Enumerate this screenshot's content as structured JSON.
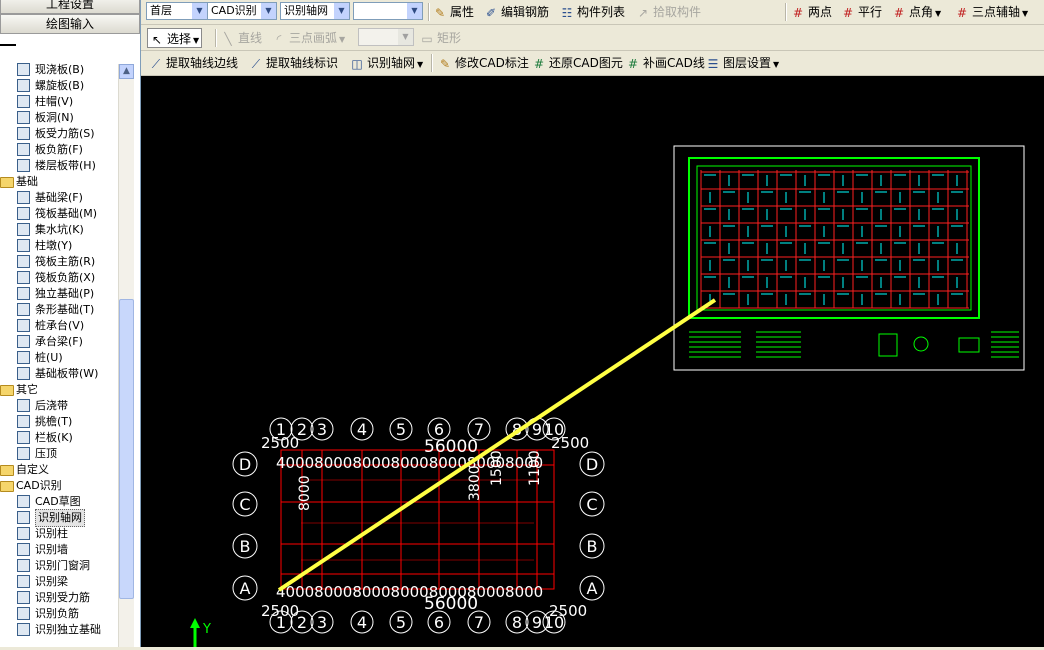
{
  "left_panel": {
    "top_buttons": [
      "工程设置",
      "绘图输入"
    ],
    "tree_items": [
      {
        "label": "现浇板(B)",
        "icon": "cast-slab-icon"
      },
      {
        "label": "螺旋板(B)",
        "icon": "spiral-slab-icon"
      },
      {
        "label": "柱帽(V)",
        "icon": "column-cap-icon"
      },
      {
        "label": "板洞(N)",
        "icon": "slab-hole-icon"
      },
      {
        "label": "板受力筋(S)",
        "icon": "slab-rebar-icon"
      },
      {
        "label": "板负筋(F)",
        "icon": "slab-negative-rebar-icon"
      },
      {
        "label": "楼层板带(H)",
        "icon": "floor-strip-icon"
      },
      {
        "label": "基础",
        "folder": true,
        "icon": "folder-icon"
      },
      {
        "label": "基础梁(F)",
        "icon": "foundation-beam-icon"
      },
      {
        "label": "筏板基础(M)",
        "icon": "raft-foundation-icon"
      },
      {
        "label": "集水坑(K)",
        "icon": "sump-pit-icon"
      },
      {
        "label": "柱墩(Y)",
        "icon": "column-pier-icon"
      },
      {
        "label": "筏板主筋(R)",
        "icon": "raft-main-rebar-icon"
      },
      {
        "label": "筏板负筋(X)",
        "icon": "raft-negative-rebar-icon"
      },
      {
        "label": "独立基础(P)",
        "icon": "isolated-foundation-icon"
      },
      {
        "label": "条形基础(T)",
        "icon": "strip-foundation-icon"
      },
      {
        "label": "桩承台(V)",
        "icon": "pile-cap-icon"
      },
      {
        "label": "承台梁(F)",
        "icon": "cap-beam-icon"
      },
      {
        "label": "桩(U)",
        "icon": "pile-icon"
      },
      {
        "label": "基础板带(W)",
        "icon": "foundation-strip-icon"
      },
      {
        "label": "其它",
        "folder": true,
        "icon": "folder-icon"
      },
      {
        "label": "后浇带",
        "icon": "post-cast-strip-icon"
      },
      {
        "label": "挑檐(T)",
        "icon": "eave-icon"
      },
      {
        "label": "栏板(K)",
        "icon": "parapet-icon"
      },
      {
        "label": "压顶",
        "icon": "coping-icon"
      },
      {
        "label": "自定义",
        "folder": true,
        "icon": "folder-icon"
      },
      {
        "label": "CAD识别",
        "folder": true,
        "icon": "folder-icon"
      },
      {
        "label": "CAD草图",
        "icon": "cad-sketch-icon"
      },
      {
        "label": "识别轴网",
        "icon": "identify-axis-icon",
        "selected": true
      },
      {
        "label": "识别柱",
        "icon": "identify-column-icon"
      },
      {
        "label": "识别墙",
        "icon": "identify-wall-icon"
      },
      {
        "label": "识别门窗洞",
        "icon": "identify-opening-icon"
      },
      {
        "label": "识别梁",
        "icon": "identify-beam-icon"
      },
      {
        "label": "识别受力筋",
        "icon": "identify-rebar-icon"
      },
      {
        "label": "识别负筋",
        "icon": "identify-neg-rebar-icon"
      },
      {
        "label": "识别独立基础",
        "icon": "identify-foundation-icon"
      }
    ]
  },
  "toolbar1": {
    "floor": "首层",
    "mode": "CAD识别",
    "sub_mode": "识别轴网",
    "empty_combo": "",
    "properties": "属性",
    "edit_rebar": "编辑钢筋",
    "component_list": "构件列表",
    "pick_component": "拾取构件",
    "two_point": "两点",
    "parallel": "平行",
    "point_angle": "点角",
    "three_point_axis": "三点辅轴"
  },
  "toolbar2": {
    "select": "选择",
    "line": "直线",
    "arc": "三点画弧",
    "rect": "矩形"
  },
  "toolbar3": {
    "extract_axis_edge": "提取轴线边线",
    "extract_axis_label": "提取轴线标识",
    "identify_axis": "识别轴网",
    "modify_cad_label": "修改CAD标注",
    "restore_cad": "还原CAD图元",
    "patch_cad_line": "补画CAD线",
    "layer_settings": "图层设置"
  },
  "drawing": {
    "axis_numbers": [
      "1",
      "2",
      "3",
      "4",
      "5",
      "6",
      "7",
      "8",
      "9",
      "10"
    ],
    "axis_letters": [
      "A",
      "B",
      "C",
      "D"
    ],
    "total_length": "56000",
    "dims_text": "4000800080008000800080008000",
    "side_dim": "2500",
    "other_dims": [
      "1500",
      "3800",
      "8000",
      "1100"
    ],
    "y_label": "Y",
    "colors": {
      "axis": "#ffffff",
      "grid": "#ff0000",
      "highlight": "#ffff44",
      "green": "#00ff00",
      "cyan": "#00ffff"
    }
  }
}
